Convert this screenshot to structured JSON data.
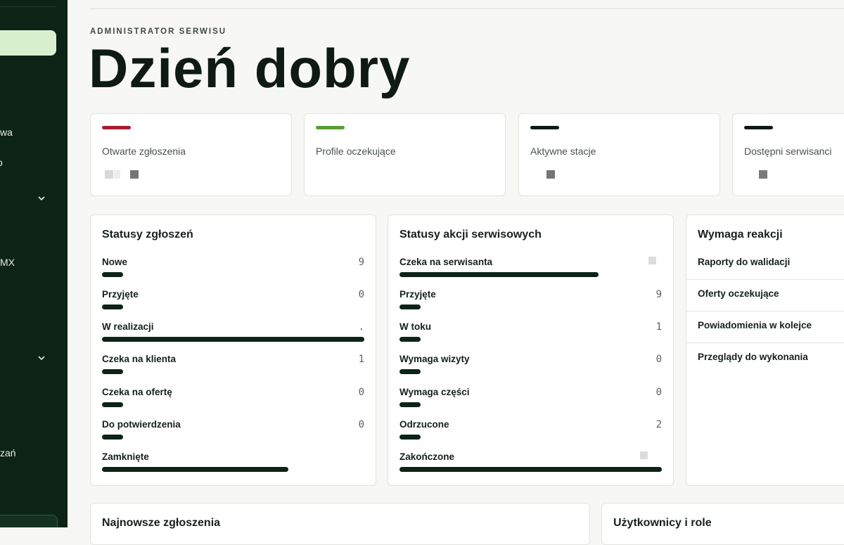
{
  "sidebar": {
    "items": [
      {
        "label": "wa"
      },
      {
        "label": "o"
      },
      {
        "label": "MX"
      },
      {
        "label": "zań"
      }
    ]
  },
  "header": {
    "role": "ADMINISTRATOR SERWISU",
    "greeting": "Dzień dobry"
  },
  "kpis": [
    {
      "label": "Otwarte zgłoszenia",
      "accent": "#a61b35"
    },
    {
      "label": "Profile oczekujące",
      "accent": "#5a9e32"
    },
    {
      "label": "Aktywne stacje",
      "accent": "#0f1a13"
    },
    {
      "label": "Dostępni serwisanci",
      "accent": "#0f1a13"
    }
  ],
  "ticket_statuses": {
    "title": "Statusy zgłoszeń",
    "rows": [
      {
        "label": "Nowe",
        "count": "9"
      },
      {
        "label": "Przyjęte",
        "count": "0"
      },
      {
        "label": "W realizacji",
        "count": "."
      },
      {
        "label": "Czeka na klienta",
        "count": "1"
      },
      {
        "label": "Czeka na ofertę",
        "count": "0"
      },
      {
        "label": "Do potwierdzenia",
        "count": "0"
      },
      {
        "label": "Zamknięte",
        "count": ""
      }
    ]
  },
  "service_statuses": {
    "title": "Statusy akcji serwisowych",
    "rows": [
      {
        "label": "Czeka na serwisanta",
        "count": ""
      },
      {
        "label": "Przyjęte",
        "count": "9"
      },
      {
        "label": "W toku",
        "count": "1"
      },
      {
        "label": "Wymaga wizyty",
        "count": "0"
      },
      {
        "label": "Wymaga części",
        "count": "0"
      },
      {
        "label": "Odrzucone",
        "count": "2"
      },
      {
        "label": "Zakończone",
        "count": ""
      }
    ]
  },
  "requires_action": {
    "title": "Wymaga reakcji",
    "items": [
      {
        "label": "Raporty do walidacji"
      },
      {
        "label": "Oferty oczekujące"
      },
      {
        "label": "Powiadomienia w kolejce"
      },
      {
        "label": "Przeglądy do wykonania"
      }
    ]
  },
  "bottom_panels": {
    "latest_tickets": "Najnowsze zgłoszenia",
    "users_roles": "Użytkownicy i role"
  },
  "colors": {
    "sidebar": "#0c2416",
    "sidebar_active": "#d9f0cf",
    "bar": "#0c2416"
  }
}
